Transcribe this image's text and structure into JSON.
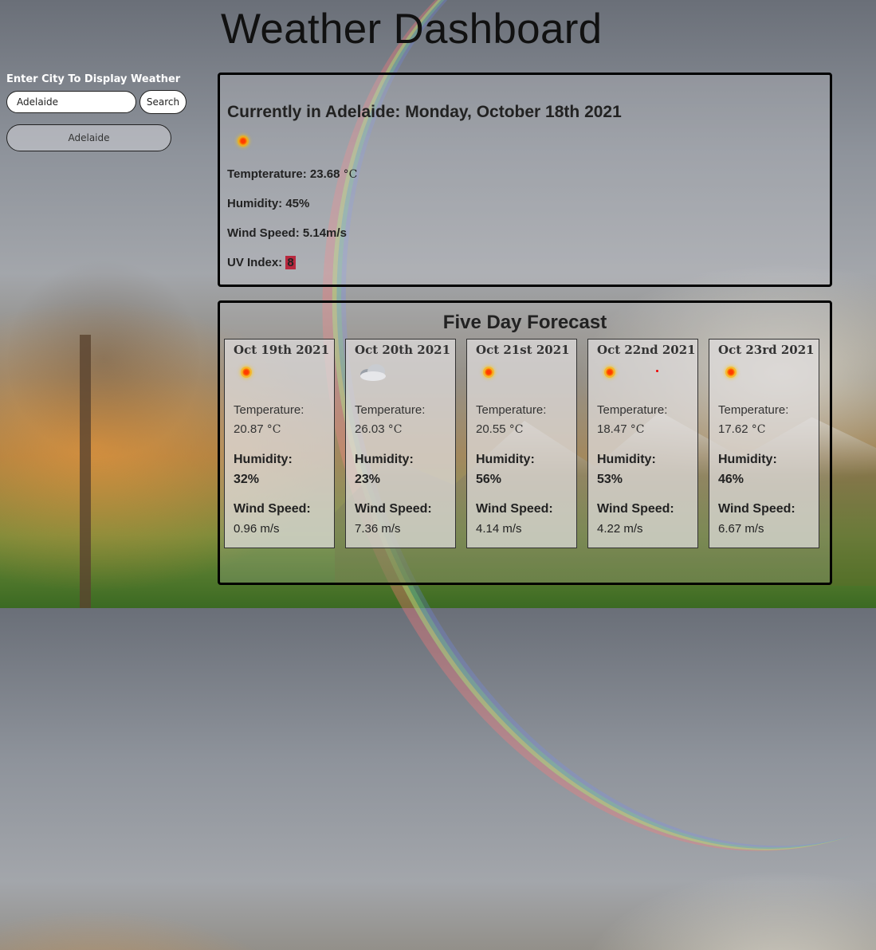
{
  "app": {
    "title": "Weather Dashboard"
  },
  "sidebar": {
    "label": "Enter City To Display Weather",
    "search_value": "Adelaide",
    "search_button": "Search",
    "history": [
      "Adelaide"
    ]
  },
  "current": {
    "heading": "Currently in Adelaide: Monday, October 18th 2021",
    "icon": "sun-icon",
    "temp_label": "Tempterature: 23.68 ",
    "temp_unit": "°C",
    "humidity": "Humidity: 45%",
    "wind": "Wind Speed: 5.14m/s",
    "uv_label": "UV Index: ",
    "uv_value": "8",
    "uv_color": "#b8283e"
  },
  "forecast": {
    "title": "Five Day Forecast",
    "temp_label": "Temperature:",
    "humidity_label": "Humidity:",
    "wind_label": "Wind Speed:",
    "unit": "°C",
    "days": [
      {
        "date": "Oct 19th 2021",
        "icon": "sun-icon",
        "temp": "20.87 ",
        "humidity": "32%",
        "wind": "0.96 m/s"
      },
      {
        "date": "Oct 20th 2021",
        "icon": "cloud-icon",
        "temp": "26.03 ",
        "humidity": "23%",
        "wind": "7.36 m/s"
      },
      {
        "date": "Oct 21st 2021",
        "icon": "sun-icon",
        "temp": "20.55 ",
        "humidity": "56%",
        "wind": "4.14 m/s"
      },
      {
        "date": "Oct 22nd 2021",
        "icon": "sun-icon",
        "temp": "18.47 ",
        "humidity": "53%",
        "wind": "4.22 m/s"
      },
      {
        "date": "Oct 23rd 2021",
        "icon": "sun-icon",
        "temp": "17.62 ",
        "humidity": "46%",
        "wind": "6.67 m/s"
      }
    ]
  }
}
